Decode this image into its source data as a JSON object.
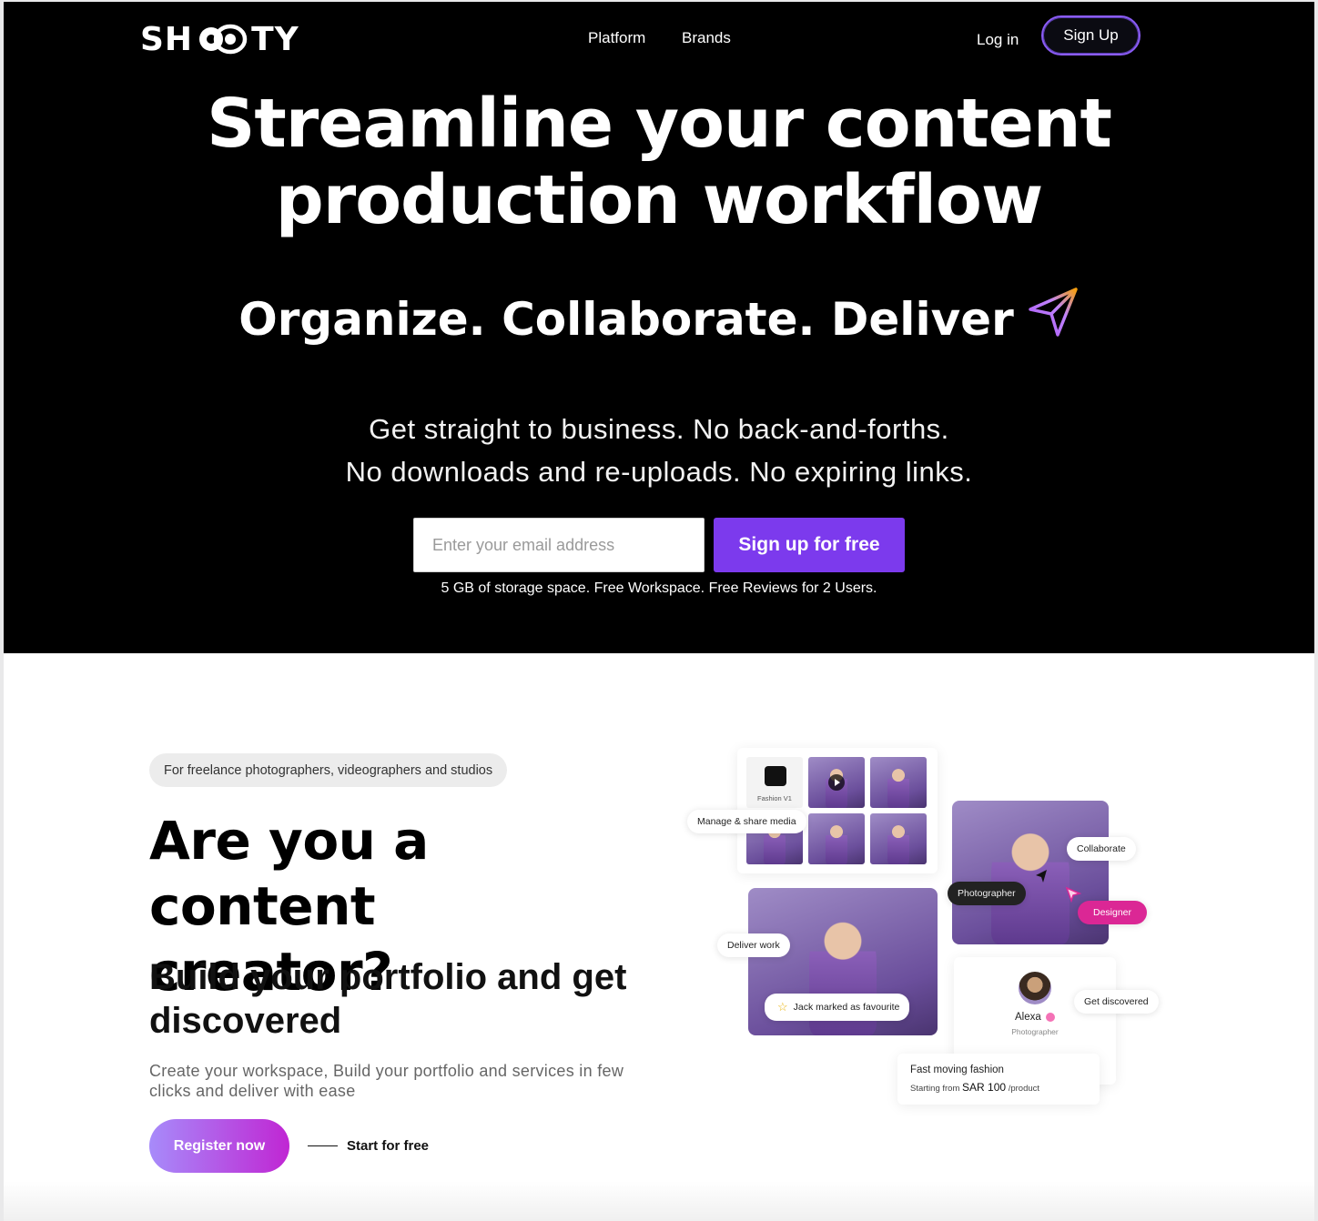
{
  "header": {
    "logo_text": "SHOOTY",
    "nav": [
      "Platform",
      "Brands"
    ],
    "login_label": "Log in",
    "signup_label": "Sign Up"
  },
  "hero": {
    "headline_line1": "Streamline your content",
    "headline_line2": "production workflow",
    "tagline": "Organize. Collaborate. Deliver",
    "sub_line1": "Get straight to business. No back-and-forths.",
    "sub_line2": "No downloads and re-uploads. No expiring links.",
    "email_placeholder": "Enter your email address",
    "cta_label": "Sign up for free",
    "storage_note": "5 GB of storage space. Free Workspace. Free Reviews for 2 Users."
  },
  "creator": {
    "pill": "For freelance photographers, videographers and studios",
    "title_line1": "Are you a content",
    "title_line2": "creator?",
    "subtitle": "Build your portfolio and get discovered",
    "description": "Create your workspace, Build your portfolio and services in few clicks and deliver with ease",
    "register_label": "Register now",
    "start_label": "Start for free"
  },
  "illustration": {
    "folder_label": "Fashion V1",
    "manage_chip": "Manage & share media",
    "collaborate_chip": "Collaborate",
    "photographer_chip": "Photographer",
    "designer_chip": "Designer",
    "deliver_chip": "Deliver work",
    "favourite_chip": "Jack marked as favourite",
    "profile_name": "Alexa",
    "profile_role": "Photographer",
    "discovered_chip": "Get discovered",
    "service_title": "Fast moving fashion",
    "service_prefix": "Starting from",
    "service_price": "SAR 100",
    "service_unit": "/product"
  },
  "colors": {
    "accent": "#7c3aed",
    "signup_border": "#8b5cf6",
    "pink": "#db2795",
    "hero_bg": "#000000"
  }
}
